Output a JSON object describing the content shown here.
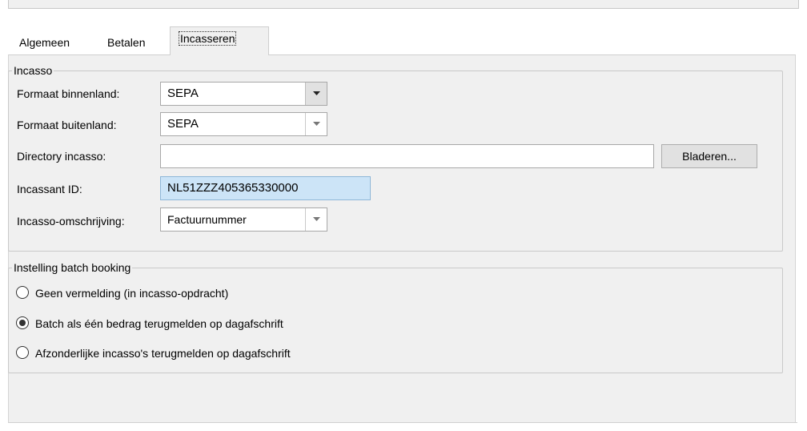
{
  "tabs": [
    {
      "label": "Algemeen"
    },
    {
      "label": "Betalen"
    },
    {
      "label": "Incasseren"
    }
  ],
  "incasso": {
    "title": "Incasso",
    "formaat_binnenland": {
      "label": "Formaat binnenland:",
      "value": "SEPA"
    },
    "formaat_buitenland": {
      "label": "Formaat buitenland:",
      "value": "SEPA"
    },
    "directory": {
      "label": "Directory incasso:",
      "value": "",
      "browse_label": "Bladeren..."
    },
    "incassant": {
      "label": "Incassant ID:",
      "value": "NL51ZZZ405365330000"
    },
    "omschrijving": {
      "label": "Incasso-omschrijving:",
      "value": "Factuurnummer"
    }
  },
  "batch": {
    "title": "Instelling batch booking",
    "options": [
      {
        "label": "Geen vermelding (in incasso-opdracht)",
        "selected": false
      },
      {
        "label": "Batch als één bedrag terugmelden op dagafschrift",
        "selected": true
      },
      {
        "label": "Afzonderlijke incasso's terugmelden op dagafschrift",
        "selected": false
      }
    ]
  },
  "icons": {
    "dropdown": "chevron-down-icon"
  }
}
